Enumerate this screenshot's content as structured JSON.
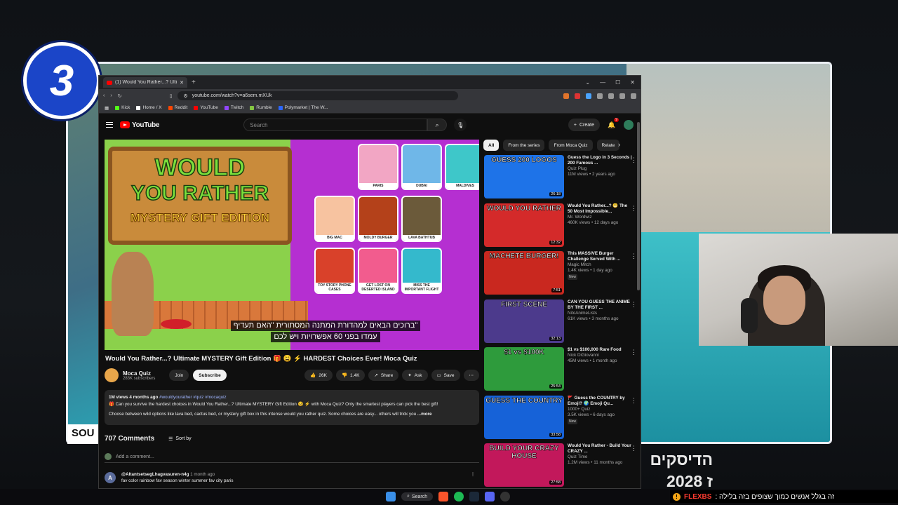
{
  "overlay": {
    "step_number": "3",
    "sound_label": "SOU",
    "hebrew_caption_line1": "הדיסקים",
    "hebrew_caption_line2": "2028 ז",
    "ticker_brand": "FLEXBS",
    "ticker_text": ": זה בגלל אנשים כמוך שצופים בזה בלילה"
  },
  "browser": {
    "tab_title": "(1) Would You Rather...? Ultim",
    "url": "youtube.com/watch?v=a6sem.mXUk",
    "bookmarks": [
      {
        "label": "Kick",
        "color": "#53fc18"
      },
      {
        "label": "Home / X",
        "color": "#ffffff"
      },
      {
        "label": "Reddit",
        "color": "#ff4500"
      },
      {
        "label": "YouTube",
        "color": "#ff0000"
      },
      {
        "label": "Twitch",
        "color": "#9146ff"
      },
      {
        "label": "Rumble",
        "color": "#85c742"
      },
      {
        "label": "Polymarket | The W...",
        "color": "#2b66ff"
      }
    ]
  },
  "youtube": {
    "logo": "YouTube",
    "search_placeholder": "Search",
    "create_label": "Create",
    "notif_count": "9",
    "player": {
      "sign_line1": "WOULD",
      "sign_line2": "YOU RATHER",
      "sign_line3": "MYSTERY GIFT EDITION",
      "tiles": [
        "PARIS",
        "DUBAI",
        "MALDIVES",
        "BIG MAC",
        "MOLDY BURGER",
        "LAVA BATHTUB",
        "TOY STORY PHONE CASES",
        "GET LOST ON DESERTED ISLAND",
        "MISS THE IMPORTANT FLIGHT"
      ],
      "subtitle_line1": "ברוכים הבאים למהדורת המתנה המסתורית \"האם תעדיף\"",
      "subtitle_line2": "עמדו בפני 60 אפשרויות ויש לכם"
    },
    "video": {
      "title": "Would You Rather...? Ultimate MYSTERY Gift Edition 🎁 😩 ⚡ HARDEST Choices Ever! Moca Quiz",
      "channel": "Moca Quiz",
      "subscribers": "283K subscribers",
      "join": "Join",
      "subscribe": "Subscribe",
      "likes": "26K",
      "dislikes": "1.4K",
      "share": "Share",
      "ask": "Ask",
      "save": "Save"
    },
    "description": {
      "views_time": "1M views  4 months ago",
      "tags": "#wouldyourather #quiz #mocaquiz",
      "line1": "🎁 Can you survive the hardest choices in Would You Rather...? Ultimate MYSTERY Gift Edition 😩 ⚡ with Moca Quiz? Only the smartest players can pick the best gift!",
      "line2": "Choose between wild options like lava bed, cactus bed, or mystery gift box in this intense would you rather quiz. Some choices are easy... others will trick you",
      "more": "...more"
    },
    "comments": {
      "count": "707 Comments",
      "sort": "Sort by",
      "add_placeholder": "Add a comment...",
      "first": {
        "author": "@AltantsetsegLhagvasuren-n4g",
        "time": "1 month ago",
        "text": "fav color rainbow fav season winter summer fav city paris",
        "initial": "A"
      }
    },
    "chips": [
      "All",
      "From the series",
      "From Moca Quiz",
      "Relate"
    ],
    "recommendations": [
      {
        "thumb_text": "GUESS 200 LOGOS",
        "thumb_color": "#1e73e8",
        "duration": "26:18",
        "title": "Guess the Logo in 3 Seconds | 200 Famous ...",
        "channel": "Quiz Plug",
        "meta": "11M views • 2 years ago",
        "badge": ""
      },
      {
        "thumb_text": "WOULD YOU RATHER",
        "thumb_color": "#d42a2a",
        "duration": "12:32",
        "title": "Would You Rather...? 😬 The 50 Most Impossible...",
        "channel": "Mr. Wordwiz",
        "meta": "460K views • 12 days ago",
        "badge": ""
      },
      {
        "thumb_text": "MACHETE BURGER!",
        "thumb_color": "#c9281f",
        "duration": "7:51",
        "title": "This MASSIVE Burger Challenge Served With ...",
        "channel": "Magic Mitch",
        "meta": "1.4K views • 1 day ago",
        "badge": "New"
      },
      {
        "thumb_text": "FIRST SCENE",
        "thumb_color": "#4c3a8c",
        "duration": "32:13",
        "title": "CAN YOU GUESS THE ANIME BY THE FIRST ...",
        "channel": "NitoAnimeLists",
        "meta": "61K views • 3 months ago",
        "badge": ""
      },
      {
        "thumb_text": "$1 vs $100K",
        "thumb_color": "#2e9b3c",
        "duration": "25:54",
        "title": "$1 vs $100,000 Rare Food",
        "channel": "Nick DiGiovanni",
        "meta": "45M views • 1 month ago",
        "badge": ""
      },
      {
        "thumb_text": "GUESS THE COUNTRY",
        "thumb_color": "#1662d8",
        "duration": "33:58",
        "title": "🚩 Guess the COUNTRY by Emoji? 🌍 Emoji Qu...",
        "channel": "1000+ Quiz",
        "meta": "3.5K views • 6 days ago",
        "badge": "New"
      },
      {
        "thumb_text": "BUILD YOUR CRAZY HOUSE",
        "thumb_color": "#c2185b",
        "duration": "27:58",
        "title": "Would You Rather - Build Your CRAZY ...",
        "channel": "Quiz Time",
        "meta": "1.2M views • 11 months ago",
        "badge": ""
      }
    ]
  },
  "taskbar": {
    "search_label": "Search"
  }
}
